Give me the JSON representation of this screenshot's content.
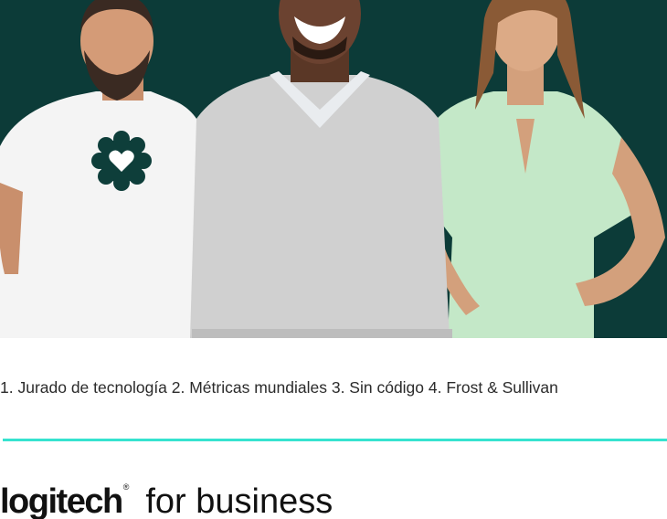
{
  "hero": {
    "background_color": "#0c3b38",
    "people": [
      "man-white-tshirt-heart-badge",
      "man-grey-sweater",
      "woman-mint-dress"
    ],
    "badge_icon": "heart-flower-icon"
  },
  "footnotes": {
    "text": "1. Jurado de tecnología 2. Métricas mundiales 3. Sin código 4. Frost & Sullivan"
  },
  "divider": {
    "color": "#36e3cf"
  },
  "brand": {
    "logo": "logitech",
    "registered": "®",
    "suffix": "for business"
  }
}
